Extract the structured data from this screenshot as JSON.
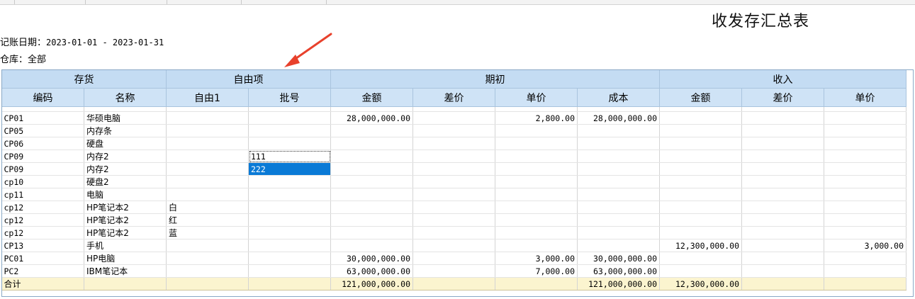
{
  "report": {
    "title": "收发存汇总表",
    "date_label": "记账日期：",
    "date_value": "2023-01-01 - 2023-01-31",
    "warehouse_label": "仓库：",
    "warehouse_value": "全部"
  },
  "headers": {
    "group": [
      "存货",
      "自由项",
      "期初",
      "收入"
    ],
    "columns": [
      "编码",
      "名称",
      "自由1",
      "批号",
      "金额",
      "差价",
      "单价",
      "成本",
      "金额",
      "差价",
      "单价"
    ]
  },
  "rows": [
    {
      "code": "CP01",
      "name": "华硕电脑",
      "free1": "",
      "batch": "",
      "amount": "28,000,000.00",
      "diff": "",
      "price": "2,800.00",
      "cost": "28,000,000.00",
      "in_amount": "",
      "in_diff": "",
      "in_price": ""
    },
    {
      "code": "CP05",
      "name": "内存条",
      "free1": "",
      "batch": "",
      "amount": "",
      "diff": "",
      "price": "",
      "cost": "",
      "in_amount": "",
      "in_diff": "",
      "in_price": ""
    },
    {
      "code": "CP06",
      "name": "硬盘",
      "free1": "",
      "batch": "",
      "amount": "",
      "diff": "",
      "price": "",
      "cost": "",
      "in_amount": "",
      "in_diff": "",
      "in_price": ""
    },
    {
      "code": "CP09",
      "name": "内存2",
      "free1": "",
      "batch": "111",
      "amount": "",
      "diff": "",
      "price": "",
      "cost": "",
      "in_amount": "",
      "in_diff": "",
      "in_price": ""
    },
    {
      "code": "CP09",
      "name": "内存2",
      "free1": "",
      "batch": "222",
      "amount": "",
      "diff": "",
      "price": "",
      "cost": "",
      "in_amount": "",
      "in_diff": "",
      "in_price": ""
    },
    {
      "code": "cp10",
      "name": "硬盘2",
      "free1": "",
      "batch": "",
      "amount": "",
      "diff": "",
      "price": "",
      "cost": "",
      "in_amount": "",
      "in_diff": "",
      "in_price": ""
    },
    {
      "code": "cp11",
      "name": "电脑",
      "free1": "",
      "batch": "",
      "amount": "",
      "diff": "",
      "price": "",
      "cost": "",
      "in_amount": "",
      "in_diff": "",
      "in_price": ""
    },
    {
      "code": "cp12",
      "name": "HP笔记本2",
      "free1": "白",
      "batch": "",
      "amount": "",
      "diff": "",
      "price": "",
      "cost": "",
      "in_amount": "",
      "in_diff": "",
      "in_price": ""
    },
    {
      "code": "cp12",
      "name": "HP笔记本2",
      "free1": "红",
      "batch": "",
      "amount": "",
      "diff": "",
      "price": "",
      "cost": "",
      "in_amount": "",
      "in_diff": "",
      "in_price": ""
    },
    {
      "code": "cp12",
      "name": "HP笔记本2",
      "free1": "蓝",
      "batch": "",
      "amount": "",
      "diff": "",
      "price": "",
      "cost": "",
      "in_amount": "",
      "in_diff": "",
      "in_price": ""
    },
    {
      "code": "CP13",
      "name": "手机",
      "free1": "",
      "batch": "",
      "amount": "",
      "diff": "",
      "price": "",
      "cost": "",
      "in_amount": "12,300,000.00",
      "in_diff": "",
      "in_price": "3,000.00"
    },
    {
      "code": "PC01",
      "name": "HP电脑",
      "free1": "",
      "batch": "",
      "amount": "30,000,000.00",
      "diff": "",
      "price": "3,000.00",
      "cost": "30,000,000.00",
      "in_amount": "",
      "in_diff": "",
      "in_price": ""
    },
    {
      "code": "PC2",
      "name": "IBM笔记本",
      "free1": "",
      "batch": "",
      "amount": "63,000,000.00",
      "diff": "",
      "price": "7,000.00",
      "cost": "63,000,000.00",
      "in_amount": "",
      "in_diff": "",
      "in_price": ""
    }
  ],
  "total": {
    "code": "合计",
    "name": "",
    "free1": "",
    "batch": "",
    "amount": "121,000,000.00",
    "diff": "",
    "price": "",
    "cost": "121,000,000.00",
    "in_amount": "12,300,000.00",
    "in_diff": "",
    "in_price": ""
  },
  "selection": {
    "focused_row": 3,
    "selected_row": 4,
    "column": "batch"
  },
  "colors": {
    "header_bg": "#cfe3f6",
    "total_bg": "#fbf4cf",
    "selection": "#0a7ad6",
    "arrow": "#e8412c"
  }
}
